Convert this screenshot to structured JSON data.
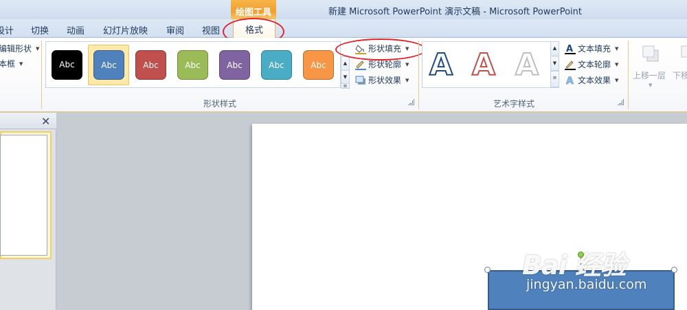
{
  "window": {
    "title": "新建 Microsoft PowerPoint 演示文稿 - Microsoft PowerPoint",
    "context_group": "绘图工具"
  },
  "tabs": [
    {
      "label": "设计"
    },
    {
      "label": "切换"
    },
    {
      "label": "动画"
    },
    {
      "label": "幻灯片放映"
    },
    {
      "label": "审阅"
    },
    {
      "label": "视图"
    }
  ],
  "active_tab": {
    "label": "格式"
  },
  "insert_shapes": {
    "edit_shape": "编辑形状",
    "text_box": "文本框"
  },
  "shape_styles": {
    "group_label": "形状样式",
    "swatches": [
      {
        "label": "Abc",
        "color": "#000000"
      },
      {
        "label": "Abc",
        "color": "#4f81bd"
      },
      {
        "label": "Abc",
        "color": "#c0504d"
      },
      {
        "label": "Abc",
        "color": "#9bbb59"
      },
      {
        "label": "Abc",
        "color": "#8064a2"
      },
      {
        "label": "Abc",
        "color": "#4bacc6"
      },
      {
        "label": "Abc",
        "color": "#f79646"
      }
    ],
    "fill": "形状填充",
    "outline": "形状轮廓",
    "effects": "形状效果"
  },
  "wordart_styles": {
    "group_label": "艺术字样式",
    "letters": [
      {
        "label": "A",
        "color": "#1f497d"
      },
      {
        "label": "A",
        "color": "#c0504d"
      },
      {
        "label": "A",
        "color": "#bfbfbf"
      }
    ],
    "text_fill": "文本填充",
    "text_outline": "文本轮廓",
    "text_effects": "文本效果"
  },
  "arrange": {
    "bring_forward": "上移一层",
    "send_backward": "下移"
  },
  "watermark": {
    "brand": "Bai   经验",
    "url": "jingyan.baidu.com"
  },
  "colors": {
    "accent_orange": "#f0a030",
    "annotation_red": "#e0242a",
    "shape_fill": "#4f81bd"
  }
}
